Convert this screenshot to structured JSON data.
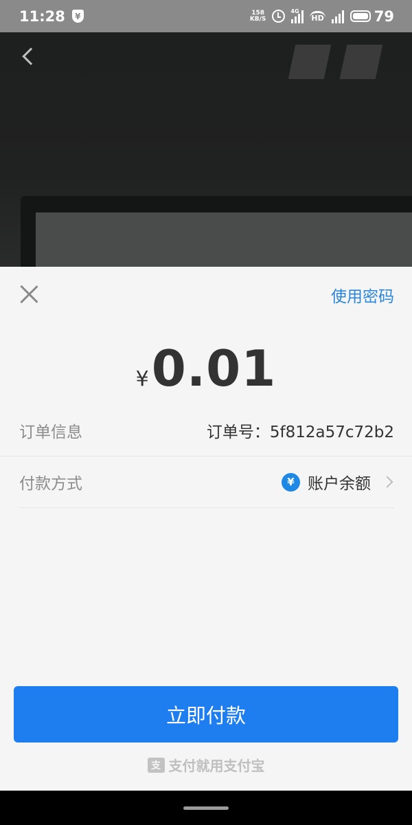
{
  "status_bar": {
    "time": "11:28",
    "shield_glyph": "¥",
    "net_speed_value": "158",
    "net_speed_unit": "KB/S",
    "network_tag": "4G",
    "hd_tag": "HD",
    "battery_level": "79"
  },
  "sheet": {
    "use_password": "使用密码",
    "amount": {
      "currency": "¥",
      "value": "0.01"
    },
    "order": {
      "label": "订单信息",
      "value": "订单号：5f812a57c72b2"
    },
    "payment": {
      "label": "付款方式",
      "icon_glyph": "¥",
      "value": "账户余额"
    },
    "pay_button": "立即付款",
    "footer": {
      "logo_glyph": "支",
      "text": "支付就用支付宝"
    }
  },
  "colors": {
    "accent": "#1e7ef0",
    "link": "#2b86d9",
    "sheet_background": "#f5f5f5",
    "status_bar": "#8a8a8a"
  },
  "icons": [
    "back-arrow-icon",
    "close-icon",
    "yen-circle-icon",
    "chevron-right-icon",
    "alipay-logo-icon",
    "alarm-icon",
    "signal-icon",
    "battery-icon"
  ]
}
